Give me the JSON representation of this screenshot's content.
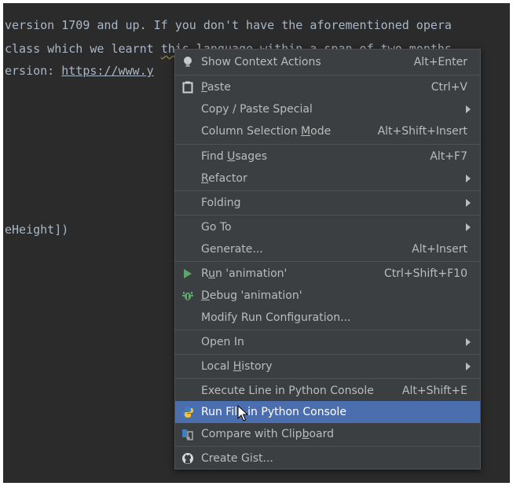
{
  "editor": {
    "line1": "version 1709 and up. If you don't have the aforementioned opera",
    "line2_a": "class which we learnt ",
    "line2_b": "this language within a span of two months",
    "line3_a": "ersion: ",
    "line3_link": "https://www.y",
    "line4": "eHeight])"
  },
  "menu": {
    "items": [
      {
        "label": "Show Context Actions",
        "shortcut": "Alt+Enter",
        "icon": "lightbulb-icon"
      },
      {
        "label_pre": "",
        "label_mn": "P",
        "label_post": "aste",
        "shortcut": "Ctrl+V",
        "icon": "clipboard-icon"
      },
      {
        "label": "Copy / Paste Special",
        "submenu": true
      },
      {
        "label_pre": "Column Selection ",
        "label_mn": "M",
        "label_post": "ode",
        "shortcut": "Alt+Shift+Insert"
      },
      {
        "label_pre": "Find ",
        "label_mn": "U",
        "label_post": "sages",
        "shortcut": "Alt+F7"
      },
      {
        "label_pre": "",
        "label_mn": "R",
        "label_post": "efactor",
        "submenu": true
      },
      {
        "label": "Folding",
        "submenu": true
      },
      {
        "label": "Go To",
        "submenu": true
      },
      {
        "label": "Generate...",
        "shortcut": "Alt+Insert"
      },
      {
        "label_pre": "R",
        "label_mn": "u",
        "label_post": "n 'animation'",
        "shortcut": "Ctrl+Shift+F10",
        "icon": "run-icon"
      },
      {
        "label_pre": "",
        "label_mn": "D",
        "label_post": "ebug 'animation'",
        "icon": "debug-icon"
      },
      {
        "label": "Modify Run Configuration..."
      },
      {
        "label": "Open In",
        "submenu": true
      },
      {
        "label_pre": "Local ",
        "label_mn": "H",
        "label_post": "istory",
        "submenu": true
      },
      {
        "label": "Execute Line in Python Console",
        "shortcut": "Alt+Shift+E"
      },
      {
        "label": "Run File in Python Console",
        "icon": "python-icon",
        "selected": true
      },
      {
        "label_pre": "Compare with Clip",
        "label_mn": "b",
        "label_post": "oard",
        "icon": "compare-icon"
      },
      {
        "label": "Create Gist...",
        "icon": "github-icon"
      }
    ]
  },
  "colors": {
    "editor_bg": "#2b2b2b",
    "menu_bg": "#3c3f41",
    "selection": "#4b6eaf",
    "run_green": "#59a869",
    "python_blue": "#3e7fc1",
    "python_yellow": "#f5c33b"
  }
}
